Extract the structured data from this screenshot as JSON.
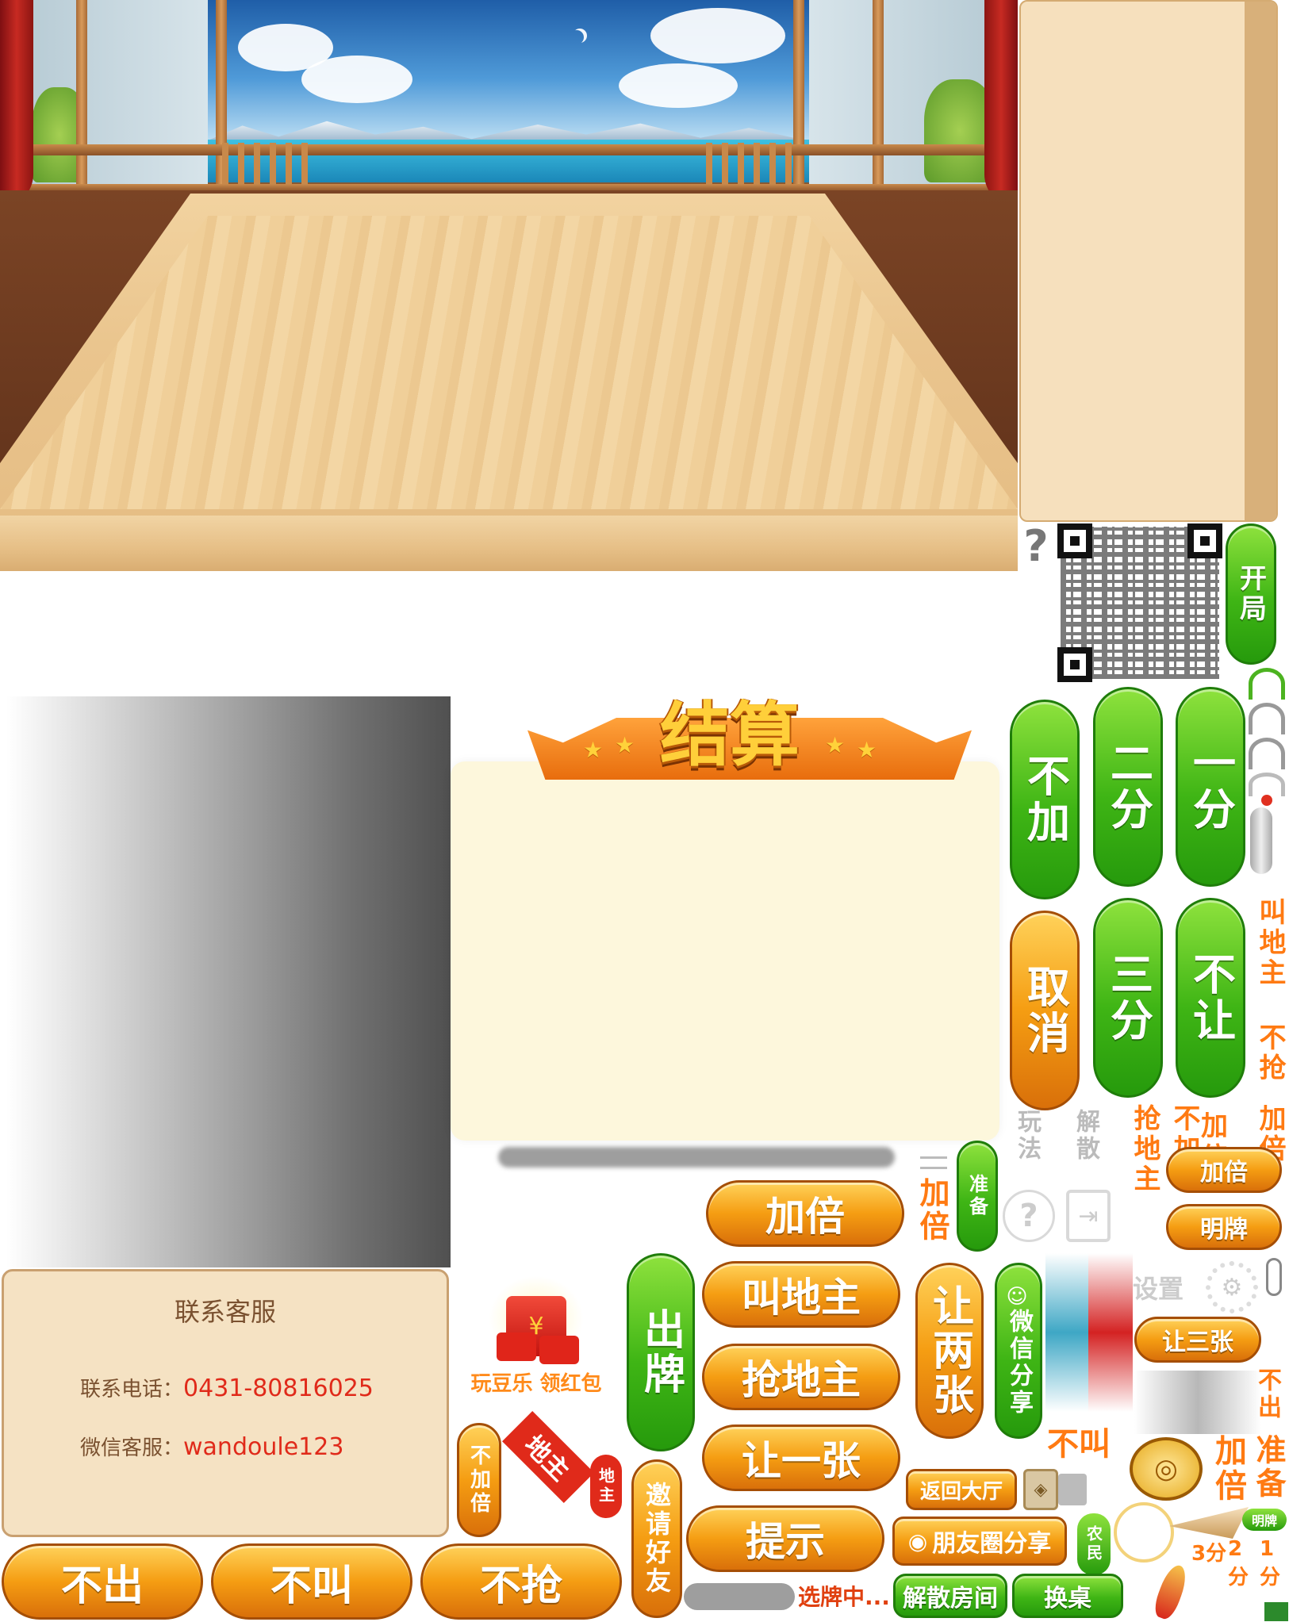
{
  "colors": {
    "green": "#3fb515",
    "orange": "#f59d12",
    "panel": "#fdf7dc",
    "red_text": "#e02a1a"
  },
  "scene": {
    "question_mark": "?"
  },
  "result": {
    "title": "结算"
  },
  "service": {
    "title": "联系客服",
    "phone_label": "联系电话：",
    "phone": "0431-80816025",
    "wechat_label": "微信客服：",
    "wechat": "wandoule123"
  },
  "buttons": {
    "kaiju": "开局",
    "bujia": "不加",
    "erfen": "二分",
    "yifen": "一分",
    "quxiao": "取消",
    "sanfen": "三分",
    "burang": "不让",
    "jiabei_big": "加倍",
    "jiao_dizhu": "叫地主",
    "qiang_dizhu": "抢地主",
    "rang_yizhang": "让一张",
    "tishi": "提示",
    "chupai": "出牌",
    "rang_liangzhang": "让两张",
    "weixin_fenxiang": "微信分享",
    "zhunbei_small": "准备",
    "buchu": "不出",
    "bujiao": "不叫",
    "buqiang": "不抢",
    "fanhui_dating": "返回大厅",
    "pengyouquan": "朋友圈分享",
    "jiesan_fangjian": "解散房间",
    "huanzhuo": "换桌",
    "jiabei_small": "加倍",
    "mingpai": "明牌",
    "rang_sanzhang": "让三张",
    "shezhi": "设置",
    "yaoqing": "邀请好友"
  },
  "labels": {
    "jiao_dizhu_v": "叫地主",
    "buqiang_v": "不抢",
    "jiabei_v": "加倍",
    "bujia_v": "不加",
    "qiang_dizhu_v": "抢地主",
    "jiabei_tag": "加倍",
    "wanfa": "玩法",
    "jiesan": "解散",
    "hongbao": "玩豆乐 领红包",
    "bujiabei": "不加倍",
    "dizhu": "地主",
    "dizhu_small": "地主",
    "buchu_v": "不出",
    "bujiao_v": "不叫",
    "jiabei_v2": "加倍",
    "zhunbei_v": "准备",
    "nongmin": "农民",
    "xuanpai": "选牌中...",
    "fen1": "1分",
    "fen2": "2分",
    "fen3": "3分",
    "mingpai_tag": "明牌"
  }
}
